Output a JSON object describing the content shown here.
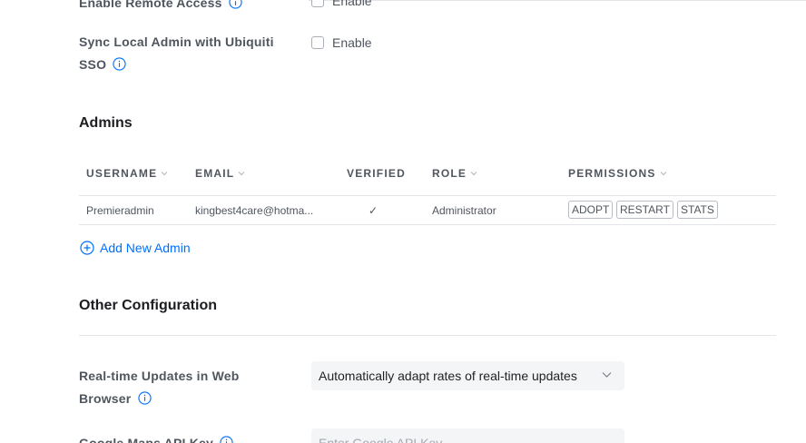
{
  "settings": {
    "remote_access": {
      "label": "Enable Remote Access",
      "checkbox_label": "Enable"
    },
    "sync_sso": {
      "label_line1": "Sync Local Admin with Ubiquiti",
      "label_line2": "SSO",
      "checkbox_label": "Enable"
    }
  },
  "admins": {
    "title": "Admins",
    "columns": {
      "username": "USERNAME",
      "email": "EMAIL",
      "verified": "VERIFIED",
      "role": "ROLE",
      "permissions": "PERMISSIONS"
    },
    "rows": [
      {
        "username": "Premieradmin",
        "email": "kingbest4care@hotma...",
        "verified": "✓",
        "role": "Administrator",
        "permissions": [
          "ADOPT",
          "RESTART",
          "STATS"
        ]
      }
    ],
    "add_label": "Add New Admin"
  },
  "other": {
    "title": "Other Configuration",
    "realtime": {
      "label_line1": "Real-time Updates in Web",
      "label_line2": "Browser",
      "selected": "Automatically adapt rates of real-time updates"
    },
    "google_maps": {
      "label": "Google Maps API Key",
      "placeholder": "Enter Google API Key"
    }
  },
  "colors": {
    "accent": "#006fff",
    "text": "#50565e",
    "heading": "#1b1d20",
    "divider": "#e3e5e9"
  }
}
